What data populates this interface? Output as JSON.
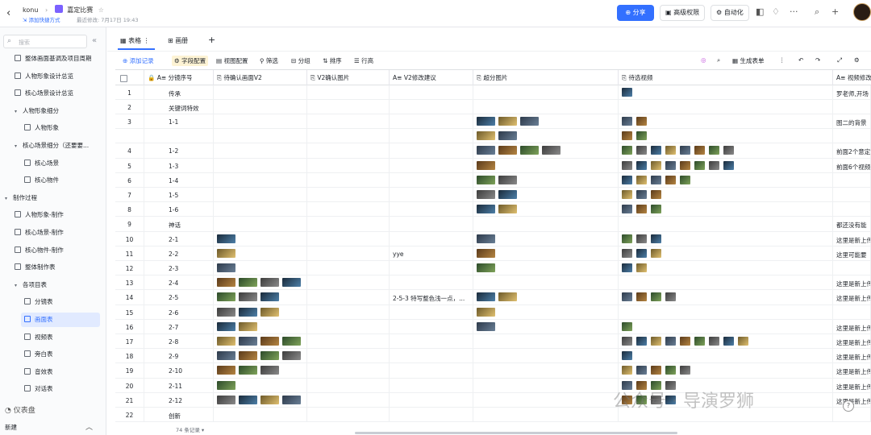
{
  "topbar": {
    "back_icon": "chevron-left-icon",
    "workspace": "konu",
    "doc_title": "嘉定比赛",
    "add_shortcut": "添加快捷方式",
    "last_modified": "最近修改: 7月17日 19:43",
    "share_label": "分享",
    "permission_label": "高级权限",
    "automation_label": "自动化"
  },
  "sidebar": {
    "search_placeholder": "搜索",
    "items": [
      {
        "label": "整体画面基调及项目周期",
        "indent": 1,
        "caret": ""
      },
      {
        "label": "人物形象设计总览",
        "indent": 1,
        "caret": ""
      },
      {
        "label": "核心场景设计总览",
        "indent": 1,
        "caret": ""
      },
      {
        "label": "人物形象细分",
        "indent": 1,
        "caret": "▾"
      },
      {
        "label": "人物形象",
        "indent": 2,
        "caret": ""
      },
      {
        "label": "核心场景细分（还要要...",
        "indent": 1,
        "caret": "▾"
      },
      {
        "label": "核心场景",
        "indent": 2,
        "caret": ""
      },
      {
        "label": "核心物件",
        "indent": 2,
        "caret": ""
      },
      {
        "label": "制作过程",
        "indent": 0,
        "caret": "▾"
      },
      {
        "label": "人物形象-制作",
        "indent": 1,
        "caret": ""
      },
      {
        "label": "核心场景-制作",
        "indent": 1,
        "caret": ""
      },
      {
        "label": "核心物件-制作",
        "indent": 1,
        "caret": ""
      },
      {
        "label": "整体制作表",
        "indent": 1,
        "caret": ""
      },
      {
        "label": "各项目表",
        "indent": 1,
        "caret": "▾"
      },
      {
        "label": "分镜表",
        "indent": 2,
        "caret": ""
      },
      {
        "label": "画面表",
        "indent": 2,
        "caret": "",
        "active": true
      },
      {
        "label": "视频表",
        "indent": 2,
        "caret": ""
      },
      {
        "label": "旁白表",
        "indent": 2,
        "caret": ""
      },
      {
        "label": "音效表",
        "indent": 2,
        "caret": ""
      },
      {
        "label": "对话表",
        "indent": 2,
        "caret": ""
      }
    ],
    "dashboard_label": "仪表盘",
    "new_label": "新建"
  },
  "tabs": [
    {
      "label": "表格"
    },
    {
      "label": "画册"
    }
  ],
  "toolbar": {
    "add_record": "添加记录",
    "field_config": "字段配置",
    "view_config": "视图配置",
    "filter": "筛选",
    "group": "分组",
    "sort": "排序",
    "row_height": "行高",
    "generate_form": "生成表单"
  },
  "columns": [
    "分镜序号",
    "待确认画面V2",
    "V2确认图片",
    "V2修改建议",
    "超分图片",
    "待选视频",
    "视频修改"
  ],
  "rows": [
    {
      "num": "1",
      "id": "传承",
      "v2": 0,
      "note": "",
      "sr": 0,
      "vid": 1,
      "remark": "罗老师,开场"
    },
    {
      "num": "2",
      "id": "关键词特效",
      "v2": 0,
      "note": "",
      "sr": 0,
      "vid": 0,
      "remark": ""
    },
    {
      "num": "3",
      "id": "1-1",
      "v2": 0,
      "note": "",
      "sr": 3,
      "vid": 2,
      "remark": "图二的背景"
    },
    {
      "num": "",
      "id": "",
      "v2": 0,
      "note": "",
      "sr": 2,
      "vid": 2,
      "remark": ""
    },
    {
      "num": "4",
      "id": "1-2",
      "v2": 0,
      "note": "",
      "sr": 4,
      "vid": 8,
      "remark": "前面2个意定"
    },
    {
      "num": "5",
      "id": "1-3",
      "v2": 0,
      "note": "",
      "sr": 1,
      "vid": 8,
      "remark": "前面6个视频"
    },
    {
      "num": "6",
      "id": "1-4",
      "v2": 0,
      "note": "",
      "sr": 2,
      "vid": 5,
      "remark": ""
    },
    {
      "num": "7",
      "id": "1-5",
      "v2": 0,
      "note": "",
      "sr": 2,
      "vid": 3,
      "remark": ""
    },
    {
      "num": "8",
      "id": "1-6",
      "v2": 0,
      "note": "",
      "sr": 2,
      "vid": 3,
      "remark": ""
    },
    {
      "num": "9",
      "id": "神话",
      "v2": 0,
      "note": "",
      "sr": 0,
      "vid": 0,
      "remark": "都还没有能"
    },
    {
      "num": "10",
      "id": "2-1",
      "v2": 1,
      "note": "",
      "sr": 1,
      "vid": 3,
      "remark": "这里是新上传"
    },
    {
      "num": "11",
      "id": "2-2",
      "v2": 1,
      "note": "yye",
      "sr": 1,
      "vid": 3,
      "remark": "这里可能要"
    },
    {
      "num": "12",
      "id": "2-3",
      "v2": 1,
      "note": "",
      "sr": 1,
      "vid": 2,
      "remark": ""
    },
    {
      "num": "13",
      "id": "2-4",
      "v2": 4,
      "note": "",
      "sr": 0,
      "vid": 0,
      "remark": "这里是新上传"
    },
    {
      "num": "14",
      "id": "2-5",
      "v2": 3,
      "note": "2-5-3 特写整色浅一点，...",
      "sr": 2,
      "vid": 4,
      "remark": "这里是新上传"
    },
    {
      "num": "15",
      "id": "2-6",
      "v2": 3,
      "note": "",
      "sr": 1,
      "vid": 0,
      "remark": ""
    },
    {
      "num": "16",
      "id": "2-7",
      "v2": 2,
      "note": "",
      "sr": 1,
      "vid": 1,
      "remark": "这里是新上传"
    },
    {
      "num": "17",
      "id": "2-8",
      "v2": 4,
      "note": "",
      "sr": 0,
      "vid": 9,
      "remark": "这里是新上传"
    },
    {
      "num": "18",
      "id": "2-9",
      "v2": 4,
      "note": "",
      "sr": 0,
      "vid": 1,
      "remark": "这里是新上传"
    },
    {
      "num": "19",
      "id": "2-10",
      "v2": 3,
      "note": "",
      "sr": 0,
      "vid": 5,
      "remark": "这里是新上传"
    },
    {
      "num": "20",
      "id": "2-11",
      "v2": 1,
      "note": "",
      "sr": 0,
      "vid": 4,
      "remark": "这里是新上传"
    },
    {
      "num": "21",
      "id": "2-12",
      "v2": 4,
      "note": "",
      "sr": 0,
      "vid": 4,
      "remark": "这里是新上传"
    },
    {
      "num": "22",
      "id": "创新",
      "v2": 0,
      "note": "",
      "sr": 0,
      "vid": 0,
      "remark": ""
    }
  ],
  "footer": {
    "record_count": "74 条记录 ▾"
  },
  "watermark": "公众号 · 导演罗狮",
  "colors": {
    "accent": "#3370ff",
    "active_bg": "#e1eaff"
  }
}
